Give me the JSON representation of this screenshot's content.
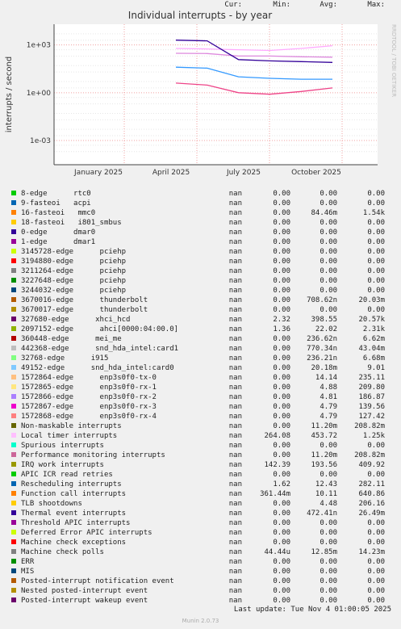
{
  "chart_data": {
    "type": "line",
    "title": "Individual interrupts - by year",
    "ylabel": "interrupts / second",
    "yscale": "log",
    "ylim": [
      3e-05,
      20000
    ],
    "y_ticks": [
      "1e+03",
      "1e+00",
      "1e-03"
    ],
    "x_ticks": [
      "January 2025",
      "April 2025",
      "July 2025",
      "October 2025"
    ],
    "side_label": "RRDTOOL / TOBI OETIKER",
    "grid": true,
    "series": [
      {
        "name": "Local timer interrupts",
        "color": "#ffaaff",
        "values": [
          600,
          560,
          500,
          450,
          600,
          900
        ]
      },
      {
        "name": "Function call interrupts",
        "color": "#ee4488",
        "values": [
          4,
          3,
          1,
          0.8,
          1.2,
          2
        ]
      },
      {
        "name": "IRQ work interrupts",
        "color": "#dd88dd",
        "values": [
          300,
          290,
          200,
          200,
          180,
          170
        ]
      },
      {
        "name": "Rescheduling interrupts",
        "color": "#3399ff",
        "values": [
          40,
          35,
          10,
          8,
          7,
          7
        ]
      },
      {
        "name": "Thermal event interrupts",
        "color": "#330099",
        "values": [
          2000,
          1800,
          120,
          100,
          90,
          80
        ]
      }
    ]
  },
  "legend": {
    "headers": {
      "cur": "Cur:",
      "min": "Min:",
      "avg": "Avg:",
      "max": "Max:"
    },
    "rows": [
      {
        "label": "8-edge      rtc0",
        "color": "#00cc00",
        "cur": "nan",
        "min": "0.00",
        "avg": "0.00",
        "max": "0.00"
      },
      {
        "label": "9-fasteoi   acpi",
        "color": "#0066b3",
        "cur": "nan",
        "min": "0.00",
        "avg": "0.00",
        "max": "0.00"
      },
      {
        "label": "16-fasteoi   mmc0",
        "color": "#ff8000",
        "cur": "nan",
        "min": "0.00",
        "avg": "84.46m",
        "max": "1.54k"
      },
      {
        "label": "18-fasteoi   i801_smbus",
        "color": "#ffcc00",
        "cur": "nan",
        "min": "0.00",
        "avg": "0.00",
        "max": "0.00"
      },
      {
        "label": "0-edge      dmar0",
        "color": "#330099",
        "cur": "nan",
        "min": "0.00",
        "avg": "0.00",
        "max": "0.00"
      },
      {
        "label": "1-edge      dmar1",
        "color": "#990099",
        "cur": "nan",
        "min": "0.00",
        "avg": "0.00",
        "max": "0.00"
      },
      {
        "label": "3145728-edge      pciehp",
        "color": "#ccff00",
        "cur": "nan",
        "min": "0.00",
        "avg": "0.00",
        "max": "0.00"
      },
      {
        "label": "3194880-edge      pciehp",
        "color": "#ff0000",
        "cur": "nan",
        "min": "0.00",
        "avg": "0.00",
        "max": "0.00"
      },
      {
        "label": "3211264-edge      pciehp",
        "color": "#808080",
        "cur": "nan",
        "min": "0.00",
        "avg": "0.00",
        "max": "0.00"
      },
      {
        "label": "3227648-edge      pciehp",
        "color": "#008f00",
        "cur": "nan",
        "min": "0.00",
        "avg": "0.00",
        "max": "0.00"
      },
      {
        "label": "3244032-edge      pciehp",
        "color": "#00487d",
        "cur": "nan",
        "min": "0.00",
        "avg": "0.00",
        "max": "0.00"
      },
      {
        "label": "3670016-edge      thunderbolt",
        "color": "#b35a00",
        "cur": "nan",
        "min": "0.00",
        "avg": "708.62n",
        "max": "20.03m"
      },
      {
        "label": "3670017-edge      thunderbolt",
        "color": "#b38f00",
        "cur": "nan",
        "min": "0.00",
        "avg": "0.00",
        "max": "0.00"
      },
      {
        "label": "327680-edge      xhci_hcd",
        "color": "#6b006b",
        "cur": "nan",
        "min": "2.32",
        "avg": "398.55",
        "max": "20.57k"
      },
      {
        "label": "2097152-edge      ahci[0000:04:00.0]",
        "color": "#8fb300",
        "cur": "nan",
        "min": "1.36",
        "avg": "22.02",
        "max": "2.31k"
      },
      {
        "label": "360448-edge      mei_me",
        "color": "#b30000",
        "cur": "nan",
        "min": "0.00",
        "avg": "236.62n",
        "max": "6.62m"
      },
      {
        "label": "442368-edge      snd_hda_intel:card1",
        "color": "#bebebe",
        "cur": "nan",
        "min": "0.00",
        "avg": "770.34n",
        "max": "43.04m"
      },
      {
        "label": "32768-edge      i915",
        "color": "#80ff80",
        "cur": "nan",
        "min": "0.00",
        "avg": "236.21n",
        "max": "6.68m"
      },
      {
        "label": "49152-edge      snd_hda_intel:card0",
        "color": "#80c9ff",
        "cur": "nan",
        "min": "0.00",
        "avg": "20.18m",
        "max": "9.01"
      },
      {
        "label": "1572864-edge      enp3s0f0-tx-0",
        "color": "#ffc080",
        "cur": "nan",
        "min": "0.00",
        "avg": "14.14",
        "max": "235.11"
      },
      {
        "label": "1572865-edge      enp3s0f0-rx-1",
        "color": "#ffe680",
        "cur": "nan",
        "min": "0.00",
        "avg": "4.88",
        "max": "209.80"
      },
      {
        "label": "1572866-edge      enp3s0f0-rx-2",
        "color": "#aa80ff",
        "cur": "nan",
        "min": "0.00",
        "avg": "4.81",
        "max": "186.87"
      },
      {
        "label": "1572867-edge      enp3s0f0-rx-3",
        "color": "#ee00cc",
        "cur": "nan",
        "min": "0.00",
        "avg": "4.79",
        "max": "139.56"
      },
      {
        "label": "1572868-edge      enp3s0f0-rx-4",
        "color": "#ff8080",
        "cur": "nan",
        "min": "0.00",
        "avg": "4.79",
        "max": "127.42"
      },
      {
        "label": "Non-maskable interrupts",
        "color": "#666600",
        "cur": "nan",
        "min": "0.00",
        "avg": "11.20m",
        "max": "208.82m"
      },
      {
        "label": "Local timer interrupts",
        "color": "#ffbfff",
        "cur": "nan",
        "min": "264.08",
        "avg": "453.72",
        "max": "1.25k"
      },
      {
        "label": "Spurious interrupts",
        "color": "#00ffcc",
        "cur": "nan",
        "min": "0.00",
        "avg": "0.00",
        "max": "0.00"
      },
      {
        "label": "Performance monitoring interrupts",
        "color": "#cc6699",
        "cur": "nan",
        "min": "0.00",
        "avg": "11.20m",
        "max": "208.82m"
      },
      {
        "label": "IRQ work interrupts",
        "color": "#999900",
        "cur": "nan",
        "min": "142.39",
        "avg": "193.56",
        "max": "409.92"
      },
      {
        "label": "APIC ICR read retries",
        "color": "#00cc00",
        "cur": "nan",
        "min": "0.00",
        "avg": "0.00",
        "max": "0.00"
      },
      {
        "label": "Rescheduling interrupts",
        "color": "#0066b3",
        "cur": "nan",
        "min": "1.62",
        "avg": "12.43",
        "max": "282.11"
      },
      {
        "label": "Function call interrupts",
        "color": "#ff8000",
        "cur": "nan",
        "min": "361.44m",
        "avg": "10.11",
        "max": "640.86"
      },
      {
        "label": "TLB shootdowns",
        "color": "#ffcc00",
        "cur": "nan",
        "min": "0.00",
        "avg": "4.48",
        "max": "206.16"
      },
      {
        "label": "Thermal event interrupts",
        "color": "#330099",
        "cur": "nan",
        "min": "0.00",
        "avg": "472.41n",
        "max": "26.49m"
      },
      {
        "label": "Threshold APIC interrupts",
        "color": "#990099",
        "cur": "nan",
        "min": "0.00",
        "avg": "0.00",
        "max": "0.00"
      },
      {
        "label": "Deferred Error APIC interrupts",
        "color": "#ccff00",
        "cur": "nan",
        "min": "0.00",
        "avg": "0.00",
        "max": "0.00"
      },
      {
        "label": "Machine check exceptions",
        "color": "#ff0000",
        "cur": "nan",
        "min": "0.00",
        "avg": "0.00",
        "max": "0.00"
      },
      {
        "label": "Machine check polls",
        "color": "#808080",
        "cur": "nan",
        "min": "44.44u",
        "avg": "12.85m",
        "max": "14.23m"
      },
      {
        "label": "ERR",
        "color": "#008f00",
        "cur": "nan",
        "min": "0.00",
        "avg": "0.00",
        "max": "0.00"
      },
      {
        "label": "MIS",
        "color": "#00487d",
        "cur": "nan",
        "min": "0.00",
        "avg": "0.00",
        "max": "0.00"
      },
      {
        "label": "Posted-interrupt notification event",
        "color": "#b35a00",
        "cur": "nan",
        "min": "0.00",
        "avg": "0.00",
        "max": "0.00"
      },
      {
        "label": "Nested posted-interrupt event",
        "color": "#b38f00",
        "cur": "nan",
        "min": "0.00",
        "avg": "0.00",
        "max": "0.00"
      },
      {
        "label": "Posted-interrupt wakeup event",
        "color": "#6b006b",
        "cur": "nan",
        "min": "0.00",
        "avg": "0.00",
        "max": "0.00"
      }
    ]
  },
  "footer": {
    "last_update": "Last update: Tue Nov  4 01:00:05 2025",
    "munin_version": "Munin 2.0.73"
  }
}
